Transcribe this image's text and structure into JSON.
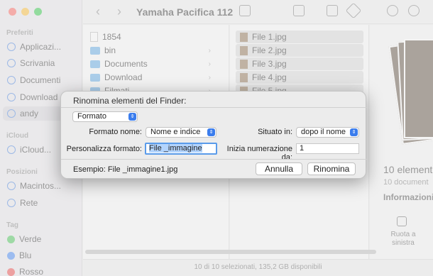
{
  "window": {
    "title": "Yamaha Pacifica 112"
  },
  "sidebar": {
    "sections": [
      {
        "label": "Preferiti",
        "items": [
          "Applicazi...",
          "Scrivania",
          "Documenti",
          "Download",
          "andy"
        ]
      },
      {
        "label": "iCloud",
        "items": [
          "iCloud..."
        ]
      },
      {
        "label": "Posizioni",
        "items": [
          "Macintos...",
          "Rete"
        ]
      },
      {
        "label": "Tag",
        "items": [
          "Verde",
          "Blu",
          "Rosso"
        ]
      }
    ],
    "tag_colors": {
      "Verde": "#3fc24e",
      "Blu": "#3b82f6",
      "Rosso": "#ef4444"
    }
  },
  "column1": {
    "items": [
      {
        "name": "1854",
        "kind": "file"
      },
      {
        "name": "bin",
        "kind": "folder"
      },
      {
        "name": "Documents",
        "kind": "folder"
      },
      {
        "name": "Download",
        "kind": "folder"
      },
      {
        "name": "Filmati",
        "kind": "folder"
      }
    ]
  },
  "column2": {
    "items": [
      "File 1.jpg",
      "File 2.jpg",
      "File 3.jpg",
      "File 4.jpg",
      "File 5.jpg"
    ]
  },
  "preview": {
    "title": "10 element",
    "subtitle": "10 document",
    "info_heading": "Informazioni",
    "rotate_label": "Ruota a sinistra"
  },
  "statusbar": {
    "text": "10 di 10 selezionati, 135,2 GB disponibili"
  },
  "dialog": {
    "title": "Rinomina elementi del Finder:",
    "mode_popup": "Formato",
    "name_format_label": "Formato nome:",
    "name_format_value": "Nome e indice",
    "where_label": "Situato in:",
    "where_value": "dopo il nome",
    "custom_format_label": "Personalizza formato:",
    "custom_format_value": "File _immagine",
    "start_number_label": "Inizia numerazione da:",
    "start_number_value": "1",
    "example": "Esempio: File _immagine1.jpg",
    "cancel_label": "Annulla",
    "rename_label": "Rinomina"
  },
  "colors": {
    "accent": "#3b7ded",
    "focus_ring": "#5a9bea"
  }
}
